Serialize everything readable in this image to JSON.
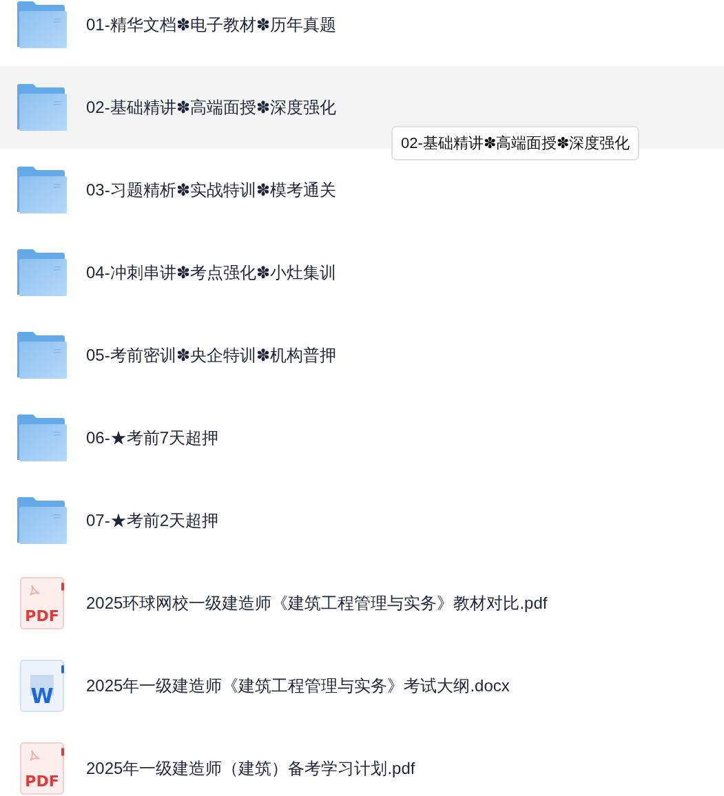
{
  "files": [
    {
      "kind": "folder",
      "name": "01-精华文档✽电子教材✽历年真题",
      "hovered": false
    },
    {
      "kind": "folder",
      "name": "02-基础精讲✽高端面授✽深度强化",
      "hovered": true
    },
    {
      "kind": "folder",
      "name": "03-习题精析✽实战特训✽模考通关",
      "hovered": false
    },
    {
      "kind": "folder",
      "name": "04-冲刺串讲✽考点强化✽小灶集训",
      "hovered": false
    },
    {
      "kind": "folder",
      "name": "05-考前密训✽央企特训✽机构普押",
      "hovered": false
    },
    {
      "kind": "folder",
      "name": "06-★考前7天超押",
      "hovered": false
    },
    {
      "kind": "folder",
      "name": "07-★考前2天超押",
      "hovered": false
    },
    {
      "kind": "pdf",
      "name": "2025环球网校一级建造师《建筑工程管理与实务》教材对比.pdf",
      "hovered": false,
      "badge": "PDF"
    },
    {
      "kind": "docx",
      "name": "2025年一级建造师《建筑工程管理与实务》考试大纲.docx",
      "hovered": false,
      "badge": "W"
    },
    {
      "kind": "pdf",
      "name": "2025年一级建造师（建筑）备考学习计划.pdf",
      "hovered": false,
      "badge": "PDF"
    }
  ],
  "tooltip": {
    "text": "02-基础精讲✽高端面授✽深度强化"
  }
}
